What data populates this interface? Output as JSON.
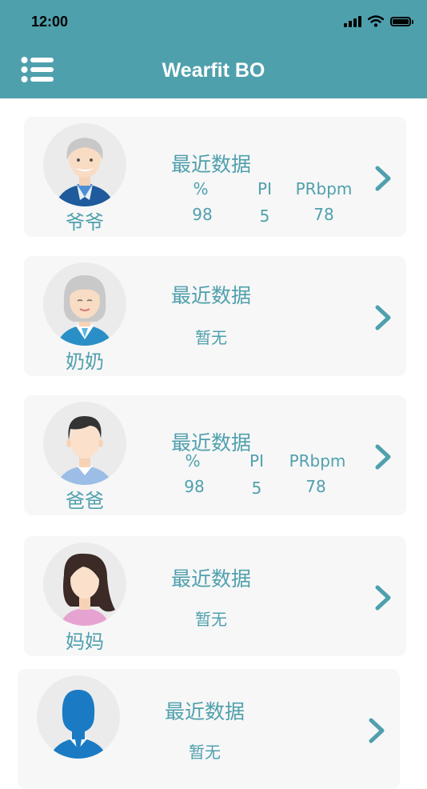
{
  "status_bar": {
    "time": "12:00"
  },
  "header": {
    "title": "Wearfit BO",
    "menu_icon": "hamburger-list-icon"
  },
  "members": [
    {
      "name": "爷爷",
      "avatar": "grandpa-avatar-icon",
      "recent_label": "最近数据",
      "columns": [
        "%",
        "PI",
        "PRbpm"
      ],
      "values": [
        "98",
        "5",
        "78"
      ],
      "empty_text": ""
    },
    {
      "name": "奶奶",
      "avatar": "grandma-avatar-icon",
      "recent_label": "最近数据",
      "columns": [],
      "values": [],
      "empty_text": "暂无"
    },
    {
      "name": "爸爸",
      "avatar": "dad-avatar-icon",
      "recent_label": "最近数据",
      "columns": [
        "%",
        "PI",
        "PRbpm"
      ],
      "values": [
        "98",
        "5",
        "78"
      ],
      "empty_text": ""
    },
    {
      "name": "妈妈",
      "avatar": "mom-avatar-icon",
      "recent_label": "最近数据",
      "columns": [],
      "values": [],
      "empty_text": "暂无"
    },
    {
      "name": "",
      "avatar": "person-silhouette-icon",
      "recent_label": "最近数据",
      "columns": [],
      "values": [],
      "empty_text": "暂无"
    }
  ],
  "colors": {
    "accent": "#4fa0ad",
    "card_bg": "#f7f7f7",
    "avatar_bg": "#ebebeb"
  }
}
